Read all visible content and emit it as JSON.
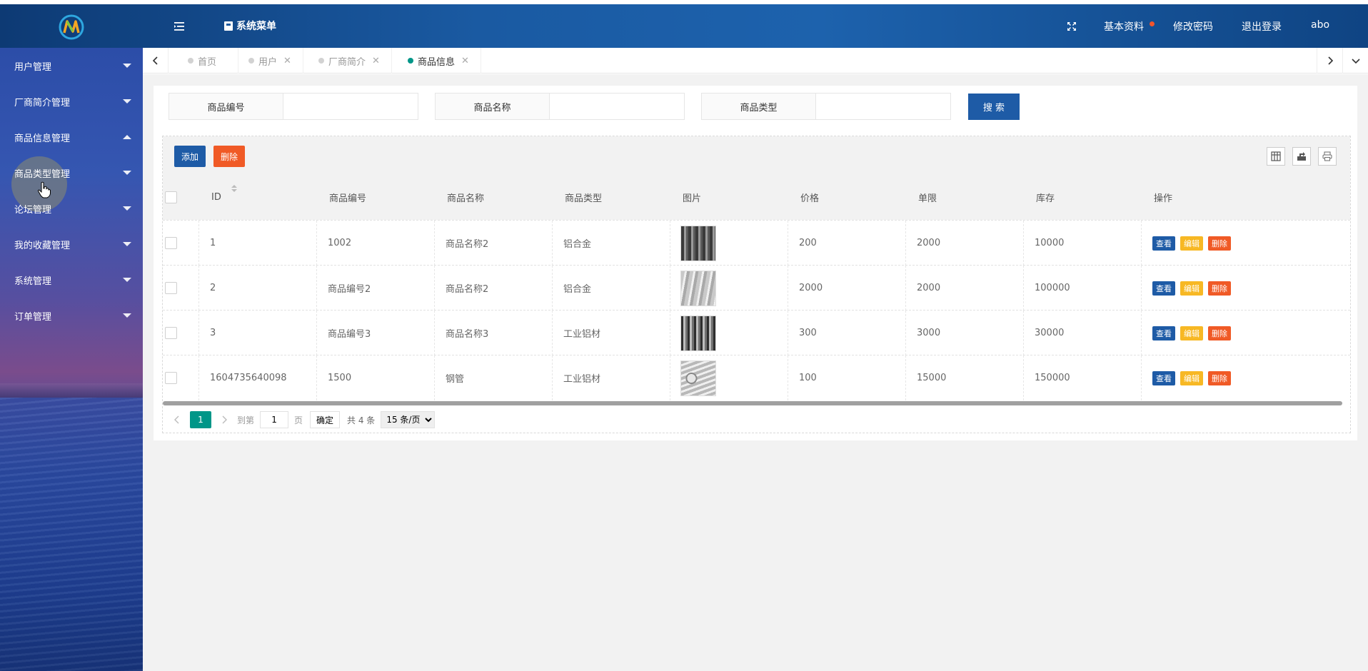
{
  "header": {
    "menu_title": "系统菜单",
    "links": {
      "profile": "基本资料",
      "change_password": "修改密码",
      "logout": "退出登录",
      "username": "abo"
    },
    "colors": {
      "header_blue": "#1d5aa0",
      "notice_dot": "#f2552c"
    }
  },
  "sidebar": {
    "items": [
      {
        "label": "用户管理",
        "expanded": false
      },
      {
        "label": "厂商简介管理",
        "expanded": false
      },
      {
        "label": "商品信息管理",
        "expanded": true
      },
      {
        "label": "商品类型管理",
        "expanded": false
      },
      {
        "label": "论坛管理",
        "expanded": false
      },
      {
        "label": "我的收藏管理",
        "expanded": false
      },
      {
        "label": "系统管理",
        "expanded": false
      },
      {
        "label": "订单管理",
        "expanded": false
      }
    ]
  },
  "tabs": [
    {
      "label": "首页",
      "closable": false,
      "active": false
    },
    {
      "label": "用户",
      "closable": true,
      "active": false
    },
    {
      "label": "厂商简介",
      "closable": true,
      "active": false
    },
    {
      "label": "商品信息",
      "closable": true,
      "active": true
    }
  ],
  "search": {
    "fields": [
      {
        "label": "商品编号",
        "value": ""
      },
      {
        "label": "商品名称",
        "value": ""
      },
      {
        "label": "商品类型",
        "value": ""
      }
    ],
    "button": "搜 索"
  },
  "toolbar": {
    "add": "添加",
    "delete": "删除"
  },
  "table": {
    "columns": [
      "ID",
      "商品编号",
      "商品名称",
      "商品类型",
      "图片",
      "价格",
      "单限",
      "库存",
      "操作"
    ],
    "rows": [
      {
        "id": "1",
        "code": "1002",
        "name": "商品名称2",
        "type": "铝合金",
        "image": "aluminum-tubes-stack",
        "price": "200",
        "limit": "2000",
        "stock": "10000"
      },
      {
        "id": "2",
        "code": "商品编号2",
        "name": "商品名称2",
        "type": "铝合金",
        "image": "aluminum-tubes-close",
        "price": "2000",
        "limit": "2000",
        "stock": "100000"
      },
      {
        "id": "3",
        "code": "商品编号3",
        "name": "商品名称3",
        "type": "工业铝材",
        "image": "aluminum-profiles",
        "price": "300",
        "limit": "3000",
        "stock": "30000"
      },
      {
        "id": "1604735640098",
        "code": "1500",
        "name": "钢管",
        "type": "工业铝材",
        "image": "steel-pipes-bundle",
        "price": "100",
        "limit": "15000",
        "stock": "150000"
      }
    ],
    "row_actions": {
      "view": "查看",
      "edit": "编辑",
      "delete": "删除"
    }
  },
  "pagination": {
    "current": "1",
    "goto_label": "到第",
    "goto_value": "1",
    "page_label": "页",
    "confirm": "确定",
    "total": "共 4 条",
    "page_size": "15 条/页"
  }
}
